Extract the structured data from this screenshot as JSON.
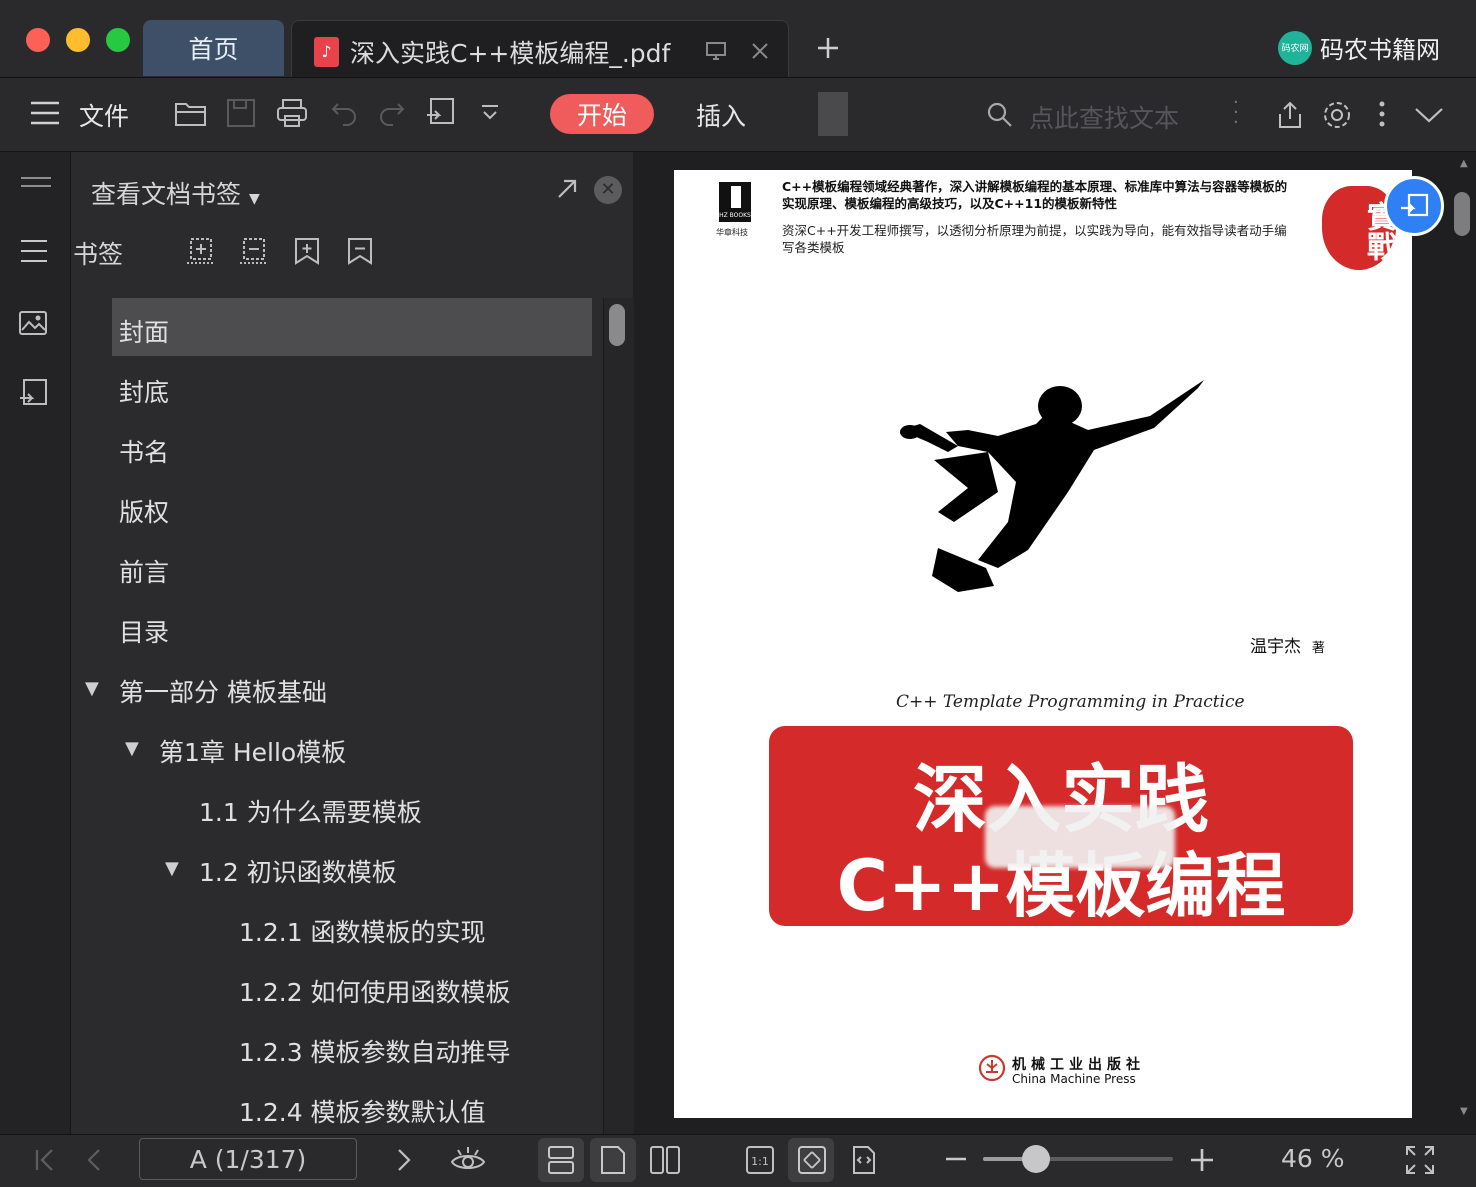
{
  "window": {
    "tabs": [
      {
        "label": "首页"
      },
      {
        "label": "深入实践C++模板编程_.pdf"
      }
    ],
    "brand": "码农书籍网",
    "brand_logo_text": "码农网"
  },
  "toolbar": {
    "menu_label": "文件",
    "start_label": "开始",
    "insert_label": "插入",
    "search_placeholder": "点此查找文本"
  },
  "panel": {
    "title": "查看文档书签",
    "bookmarks_label": "书签",
    "items": [
      {
        "label": "封面",
        "level": 0,
        "selected": true
      },
      {
        "label": "封底",
        "level": 0
      },
      {
        "label": "书名",
        "level": 0
      },
      {
        "label": "版权",
        "level": 0
      },
      {
        "label": "前言",
        "level": 0
      },
      {
        "label": "目录",
        "level": 0
      },
      {
        "label": "第一部分 模板基础",
        "level": 0,
        "expanded": true
      },
      {
        "label": "第1章 Hello模板",
        "level": 1,
        "expanded": true
      },
      {
        "label": "1.1 为什么需要模板",
        "level": 2
      },
      {
        "label": "1.2 初识函数模板",
        "level": 2,
        "expanded": true
      },
      {
        "label": "1.2.1 函数模板的实现",
        "level": 3
      },
      {
        "label": "1.2.2 如何使用函数模板",
        "level": 3
      },
      {
        "label": "1.2.3 模板参数自动推导",
        "level": 3
      },
      {
        "label": "1.2.4 模板参数默认值",
        "level": 3
      }
    ]
  },
  "document": {
    "cover": {
      "publisher_logo": "HZ BOOKS",
      "publisher_logo_sub": "华章科技",
      "blurb1": "C++模板编程领域经典著作，深入讲解模板编程的基本原理、标准库中算法与容器等模板的实现原理、模板编程的高级技巧，以及C++11的模板新特性",
      "blurb2": "资深C++开发工程师撰写，以透彻分析原理为前提，以实践为导向，能有效指导读者动手编写各类模板",
      "badge": "實戰",
      "author": "温宇杰",
      "author_suffix": "著",
      "english_title": "C++ Template Programming in Practice",
      "title_line1": "深入实践",
      "title_line2": "C++模板编程",
      "press_cn": "机械工业出版社",
      "press_en": "China Machine Press"
    }
  },
  "status": {
    "page_indicator": "A (1/317)",
    "zoom": "46 %",
    "zoom_fraction": 0.28
  },
  "colors": {
    "accent": "#f05b5b",
    "home_tab": "#3d5068",
    "cover_red": "#d42a2a"
  }
}
